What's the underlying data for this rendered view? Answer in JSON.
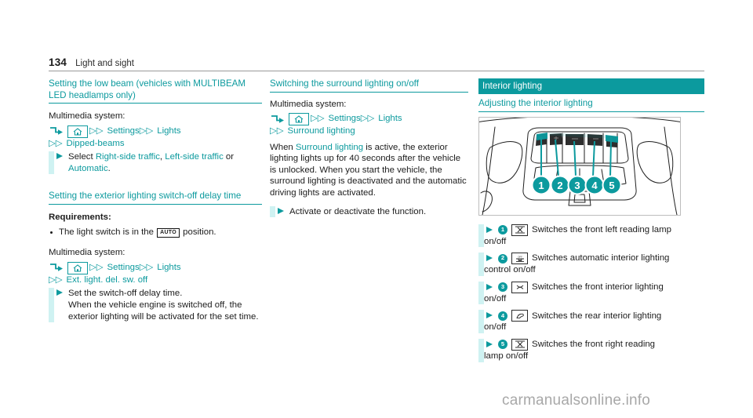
{
  "running_head": {
    "page_number": "134",
    "title": "Light and sight"
  },
  "column1": {
    "heading1": "Setting the low beam (vehicles with MULTIBEAM LED headlamps only)",
    "mm_label": "Multimedia system:",
    "path1": {
      "home_icon": "home-icon",
      "return_icon": "return-arrow-icon",
      "items": [
        "Settings",
        "Lights",
        "Dipped-beams"
      ]
    },
    "instruction1_prefix": "Select ",
    "instruction1_opt1": "Right-side traffic",
    "instruction1_sep1": ", ",
    "instruction1_opt2": "Left-side traffic",
    "instruction1_sep2": " or ",
    "instruction1_opt3": "Automatic",
    "instruction1_suffix": ".",
    "heading2": "Setting the exterior lighting switch-off delay time",
    "requirements_label": "Requirements:",
    "requirement1_pre": "The light switch is in the ",
    "requirement1_badge": "AUTO",
    "requirement1_post": " position.",
    "mm_label2": "Multimedia system:",
    "path2": {
      "home_icon": "home-icon",
      "return_icon": "return-arrow-icon",
      "items": [
        "Settings",
        "Lights",
        "Ext. light. del. sw. off"
      ]
    },
    "instruction2_line1": "Set the switch-off delay time.",
    "instruction2_line2": "When the vehicle engine is switched off, the exterior lighting will be activated for the set time."
  },
  "column2": {
    "heading1": "Switching the surround lighting on/off",
    "mm_label": "Multimedia system:",
    "path1": {
      "home_icon": "home-icon",
      "return_icon": "return-arrow-icon",
      "items": [
        "Settings",
        "Lights",
        "Surround lighting"
      ]
    },
    "para_pre": "When ",
    "para_teal": "Surround lighting",
    "para_post": " is active, the exterior lighting lights up for 40 seconds after the vehicle is unlocked. When you start the vehicle, the surround lighting is deactivated and the automatic driving lights are activated.",
    "instruction1": "Activate or deactivate the function."
  },
  "column3": {
    "section_bar": "Interior lighting",
    "heading1": "Adjusting the interior lighting",
    "figure_name": "overhead-console-illustration",
    "figure_callouts": [
      "1",
      "2",
      "3",
      "4",
      "5"
    ],
    "legend": [
      {
        "num": "1",
        "icon": "reading-lamp-icon",
        "line1": "Switches the front left reading lamp",
        "line2": "on/off"
      },
      {
        "num": "2",
        "icon": "automatic-interior-lighting-icon",
        "line1": "Switches automatic interior lighting",
        "line2": "control on/off"
      },
      {
        "num": "3",
        "icon": "front-interior-lamp-icon",
        "line1": "Switches the front interior lighting",
        "line2": "on/off"
      },
      {
        "num": "4",
        "icon": "rear-interior-lamp-icon",
        "line1": "Switches the rear interior lighting",
        "line2": "on/off"
      },
      {
        "num": "5",
        "icon": "reading-lamp-icon",
        "line1": "Switches the front right reading",
        "line2": "lamp on/off"
      }
    ]
  },
  "watermark": "carmanualsonline.info",
  "colors": {
    "teal": "#0C9A9E",
    "pale_teal": "#CFF2F2",
    "text": "#1c1c1c",
    "watermark": "#a8a8a8"
  }
}
